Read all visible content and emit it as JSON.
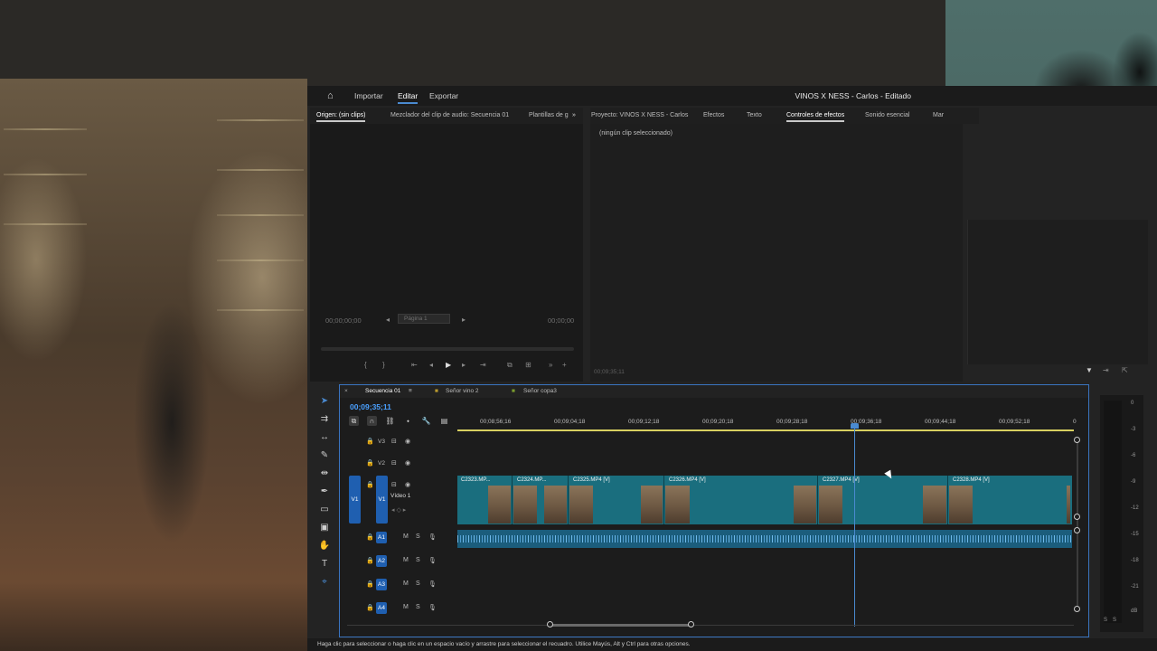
{
  "menu": {
    "home_icon": "home-icon",
    "importar": "Importar",
    "editar": "Editar",
    "exportar": "Exportar",
    "title": "VINOS X NESS - Carlos - Editado"
  },
  "source_panel": {
    "tabs": [
      "Origen: (sin clips)",
      "Mezclador del clip de audio: Secuencia 01",
      "Plantillas de g"
    ],
    "timecode_left": "00;00;00;00",
    "timecode_right": "00;00;00",
    "page": "Página 1"
  },
  "fx_panel": {
    "tabs": [
      "Proyecto: VINOS X NESS - Carlos",
      "Efectos",
      "Texto",
      "Controles de efectos",
      "Sonido esencial",
      "Mar"
    ],
    "no_clip": "(ningún clip seleccionado)",
    "timecode": "00;09;35;11"
  },
  "timeline": {
    "tabs": [
      "Secuencia 01",
      "Señor vino 2",
      "Señor copa3"
    ],
    "current_time": "00;09;35;11",
    "ruler": [
      "00;08;56;16",
      "00;09;04;18",
      "00;09;12;18",
      "00;09;20;18",
      "00;09;28;18",
      "00;09;36;18",
      "00;09;44;18",
      "00;09;52;18",
      "0"
    ],
    "tracks": {
      "v3": "V3",
      "v2": "V2",
      "v1_src": "V1",
      "v1": "V1",
      "v1_name": "Vídeo 1",
      "a1": "A1",
      "a2": "A2",
      "a3": "A3",
      "a4": "A4",
      "m": "M",
      "s": "S"
    },
    "clips": [
      "C2323.MP...",
      "C2324.MP...",
      "C2325.MP4 [V]",
      "C2326.MP4 [V]",
      "C2327.MP4 [V]",
      "C2328.MP4 [V]"
    ]
  },
  "meter": {
    "ticks": [
      "0",
      "-3",
      "-6",
      "-9",
      "-12",
      "-15",
      "-18",
      "-21",
      "dB"
    ],
    "s_labels": [
      "S",
      "S"
    ]
  },
  "status": "Haga clic para seleccionar o haga clic en un espacio vacío y arrastre para seleccionar el recuadro. Utilice Mayús, Alt y Ctrl para otras opciones.",
  "colors": {
    "accent": "#4a8ad0",
    "clip_video": "#1a6e7e",
    "clip_audio": "#1b5d7c",
    "work_area": "#d8d060",
    "track_label": "#1f5fb0"
  }
}
